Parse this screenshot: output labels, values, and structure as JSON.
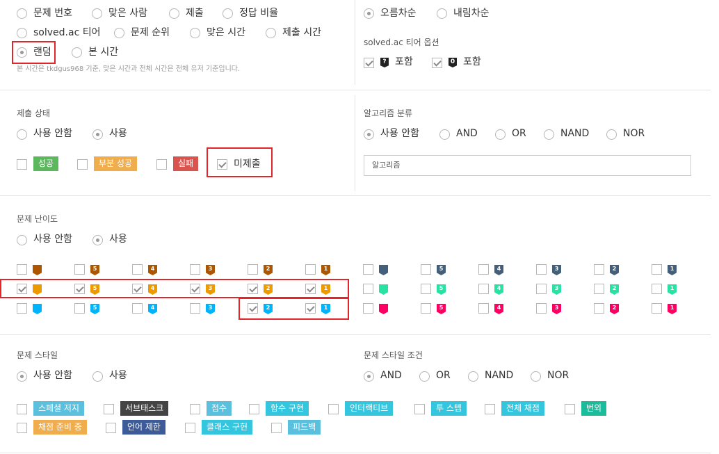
{
  "sort": {
    "fields": [
      "문제 번호",
      "맞은 사람",
      "제출",
      "정답 비율",
      "solved.ac 티어",
      "문제 순위",
      "맞은 시간",
      "제출 시간",
      "랜덤",
      "본 시간"
    ],
    "selected": "랜덤",
    "order": [
      "오름차순",
      "내림차순"
    ],
    "order_selected": "오름차순",
    "note": "본 시간은 tkdgus968 기준, 맞은 시간과 전체 시간은 전체 유저 기준입니다."
  },
  "tier_options": {
    "title": "solved.ac 티어 옵션",
    "items": [
      {
        "badge": "?",
        "label": "포함",
        "checked": true
      },
      {
        "badge": "0",
        "label": "포함",
        "checked": true
      }
    ]
  },
  "submit_status": {
    "title": "제출 상태",
    "use_options": [
      "사용 안함",
      "사용"
    ],
    "use_selected": "사용",
    "items": [
      {
        "label": "성공",
        "color": "#5cb85c",
        "checked": false
      },
      {
        "label": "부분 성공",
        "color": "#f0ad4e",
        "checked": false
      },
      {
        "label": "실패",
        "color": "#d9534f",
        "checked": false
      },
      {
        "label": "미제출",
        "color": "",
        "checked": true
      }
    ]
  },
  "algorithm": {
    "title": "알고리즘 분류",
    "options": [
      "사용 안함",
      "AND",
      "OR",
      "NAND",
      "NOR"
    ],
    "selected": "사용 안함",
    "input_placeholder": "알고리즘"
  },
  "difficulty": {
    "title": "문제 난이도",
    "use_options": [
      "사용 안함",
      "사용"
    ],
    "use_selected": "사용",
    "levels": [
      "",
      "5",
      "4",
      "3",
      "2",
      "1"
    ],
    "rows": [
      [
        {
          "tier": "bronze",
          "color": "#ad5600",
          "checked": [
            false,
            false,
            false,
            false,
            false,
            false
          ]
        },
        {
          "tier": "gold",
          "color": "#ec9a00",
          "checked": [
            true,
            true,
            true,
            true,
            true,
            true
          ]
        },
        {
          "tier": "diamond",
          "color": "#00b4fc",
          "checked": [
            false,
            false,
            false,
            false,
            true,
            true
          ]
        }
      ],
      [
        {
          "tier": "platinum",
          "color": "#435f7a",
          "checked": [
            false,
            false,
            false,
            false,
            false,
            false
          ]
        },
        {
          "tier": "emerald",
          "color": "#27e2a4",
          "checked": [
            false,
            false,
            false,
            false,
            false,
            false
          ]
        },
        {
          "tier": "ruby",
          "color": "#ff0062",
          "checked": [
            false,
            false,
            false,
            false,
            false,
            false
          ]
        }
      ]
    ]
  },
  "style": {
    "title": "문제 스타일",
    "use_options": [
      "사용 안함",
      "사용"
    ],
    "use_selected": "사용 안함",
    "tags": [
      {
        "label": "스페셜 저지",
        "color": "#5bc0de"
      },
      {
        "label": "서브태스크",
        "color": "#444444"
      },
      {
        "label": "점수",
        "color": "#5bc0de"
      },
      {
        "label": "함수 구현",
        "color": "#33c6de"
      },
      {
        "label": "인터랙티브",
        "color": "#33c6de"
      },
      {
        "label": "투 스텝",
        "color": "#33c6de"
      },
      {
        "label": "전체 채점",
        "color": "#33c6de"
      },
      {
        "label": "번외",
        "color": "#1bbc9b"
      },
      {
        "label": "채점 준비 중",
        "color": "#f0ad4e"
      },
      {
        "label": "언어 제한",
        "color": "#3d5a99"
      },
      {
        "label": "클래스 구현",
        "color": "#33c6de"
      },
      {
        "label": "피드백",
        "color": "#5bc0de"
      }
    ]
  },
  "style_cond": {
    "title": "문제 스타일 조건",
    "options": [
      "AND",
      "OR",
      "NAND",
      "NOR"
    ],
    "selected": "AND"
  },
  "colors": {
    "highlight": "#e0252b",
    "divider": "#e3e3e3"
  }
}
